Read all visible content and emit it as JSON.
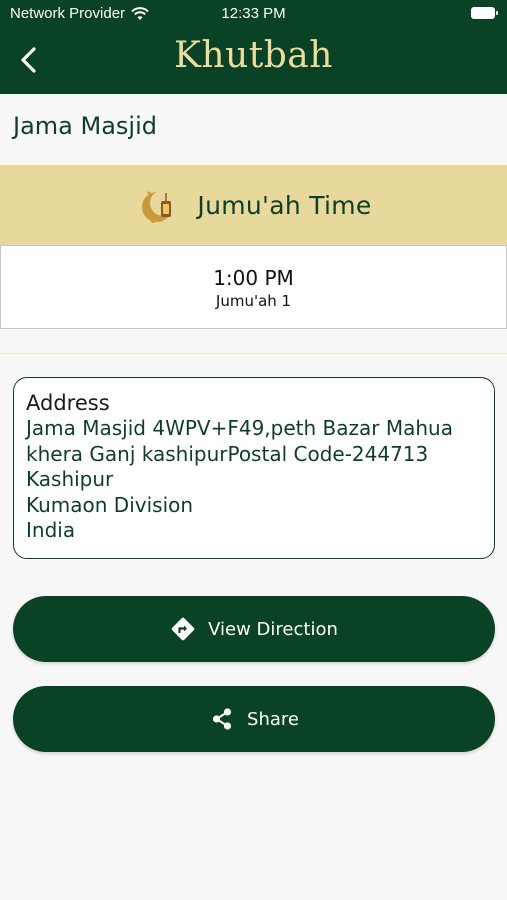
{
  "status_bar": {
    "carrier": "Network Provider",
    "time": "12:33 PM"
  },
  "nav": {
    "title": "Khutbah",
    "back_icon": "chevron-left-icon"
  },
  "masjid_name": "Jama Masjid",
  "jumuah": {
    "header_label": "Jumu'ah Time",
    "icon": "crescent-lantern-icon",
    "time": "1:00 PM",
    "name": "Jumu'ah 1"
  },
  "address": {
    "heading": "Address",
    "lines": [
      "Jama Masjid 4WPV+F49,peth Bazar Mahua",
      "khera Ganj kashipurPostal Code-244713",
      "Kashipur",
      "Kumaon Division",
      "India"
    ]
  },
  "buttons": {
    "direction_label": "View Direction",
    "direction_icon": "directions-icon",
    "share_label": "Share",
    "share_icon": "share-icon"
  },
  "colors": {
    "primary": "#0a4225",
    "gold_title": "#ecdca0",
    "header_band": "#e7d89c",
    "background": "#f7f7f7"
  }
}
